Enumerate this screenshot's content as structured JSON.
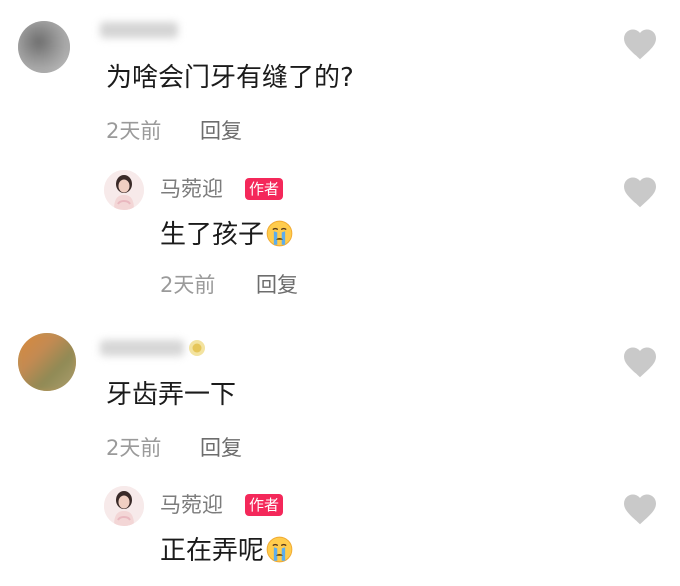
{
  "comments": [
    {
      "text": "为啥会门牙有缝了的?",
      "time": "2天前",
      "reply_label": "回复",
      "reply": {
        "author": "马菀迎",
        "badge": "作者",
        "text": "生了孩子",
        "emoji": "crying-face-icon",
        "time": "2天前",
        "reply_label": "回复"
      }
    },
    {
      "text": "牙齿弄一下",
      "time": "2天前",
      "reply_label": "回复",
      "reply": {
        "author": "马菀迎",
        "badge": "作者",
        "text": "正在弄呢",
        "emoji": "crying-face-icon"
      }
    }
  ],
  "colors": {
    "badge": "#f4285a",
    "heart": "#c9c9c9",
    "meta": "#9a9a9a"
  }
}
